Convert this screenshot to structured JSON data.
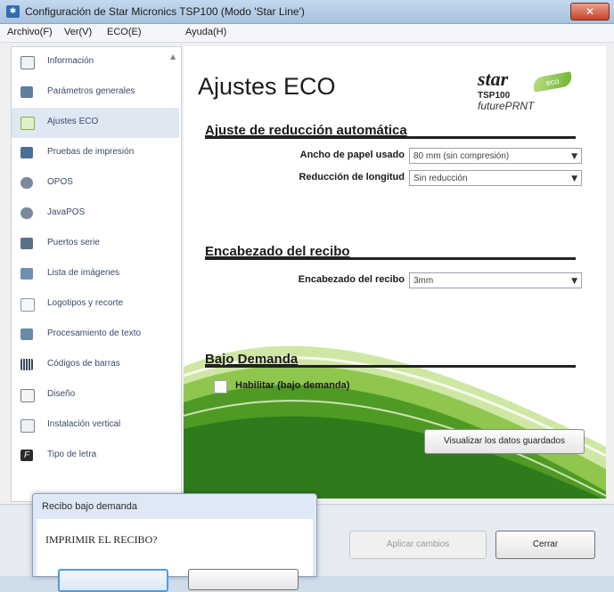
{
  "window": {
    "title": "Configuración de Star Micronics TSP100 (Modo 'Star Line')",
    "close_glyph": "✕"
  },
  "menubar": {
    "items": [
      "Archivo(F)",
      "Ver(V)",
      "ECO(E)",
      "Ayuda(H)"
    ]
  },
  "sidebar": {
    "items": [
      {
        "label": "Información",
        "icon": "info-icon",
        "color": "#6a7a8c"
      },
      {
        "label": "Parámetros generales",
        "icon": "settings-icon",
        "color": "#5f7f9f"
      },
      {
        "label": "Ajustes ECO",
        "icon": "eco-icon",
        "color": "#7fb04a"
      },
      {
        "label": "Pruebas de impresión",
        "icon": "printer-icon",
        "color": "#4a6f96"
      },
      {
        "label": "OPOS",
        "icon": "opos-icon",
        "color": "#7a8a9c"
      },
      {
        "label": "JavaPOS",
        "icon": "javapos-icon",
        "color": "#7a8a9c"
      },
      {
        "label": "Puertos serie",
        "icon": "serial-port-icon",
        "color": "#5a6f88"
      },
      {
        "label": "Lista de imágenes",
        "icon": "image-list-icon",
        "color": "#6f8fae"
      },
      {
        "label": "Logotipos y recorte",
        "icon": "logo-crop-icon",
        "color": "#8a9aab"
      },
      {
        "label": "Procesamiento de texto",
        "icon": "text-processing-icon",
        "color": "#6a8aa8"
      },
      {
        "label": "Códigos de barras",
        "icon": "barcode-icon",
        "color": "#3a4a5c"
      },
      {
        "label": "Diseño",
        "icon": "design-icon",
        "color": "#7a7a7a"
      },
      {
        "label": "Instalación vertical",
        "icon": "vertical-install-icon",
        "color": "#7a8a9c"
      },
      {
        "label": "Tipo de letra",
        "icon": "font-icon",
        "color": "#2a2a2a"
      }
    ],
    "active_index": 2
  },
  "main": {
    "title": "Ajustes ECO",
    "logo": {
      "brand": "star",
      "eco": "eco",
      "model": "TSP100",
      "sub": "futurePRNT"
    },
    "section1": {
      "title": "Ajuste de reducción automática",
      "paper_label": "Ancho de papel usado",
      "paper_value": "80 mm (sin compresión)",
      "length_label": "Reducción de longitud",
      "length_value": "Sin reducción"
    },
    "section2": {
      "title": "Encabezado del recibo",
      "header_label": "Encabezado del recibo",
      "header_value": "3mm"
    },
    "section3": {
      "title": "Bajo Demanda",
      "checkbox_label": "Habilitar (bajo demanda)",
      "checkbox_checked": false
    },
    "view_button": "Visualizar los datos guardados"
  },
  "footer": {
    "apply_label": "Aplicar cambios",
    "close_label": "Cerrar"
  },
  "dialog": {
    "title": "Recibo bajo demanda",
    "message": "IMPRIMIR EL RECIBO?"
  }
}
